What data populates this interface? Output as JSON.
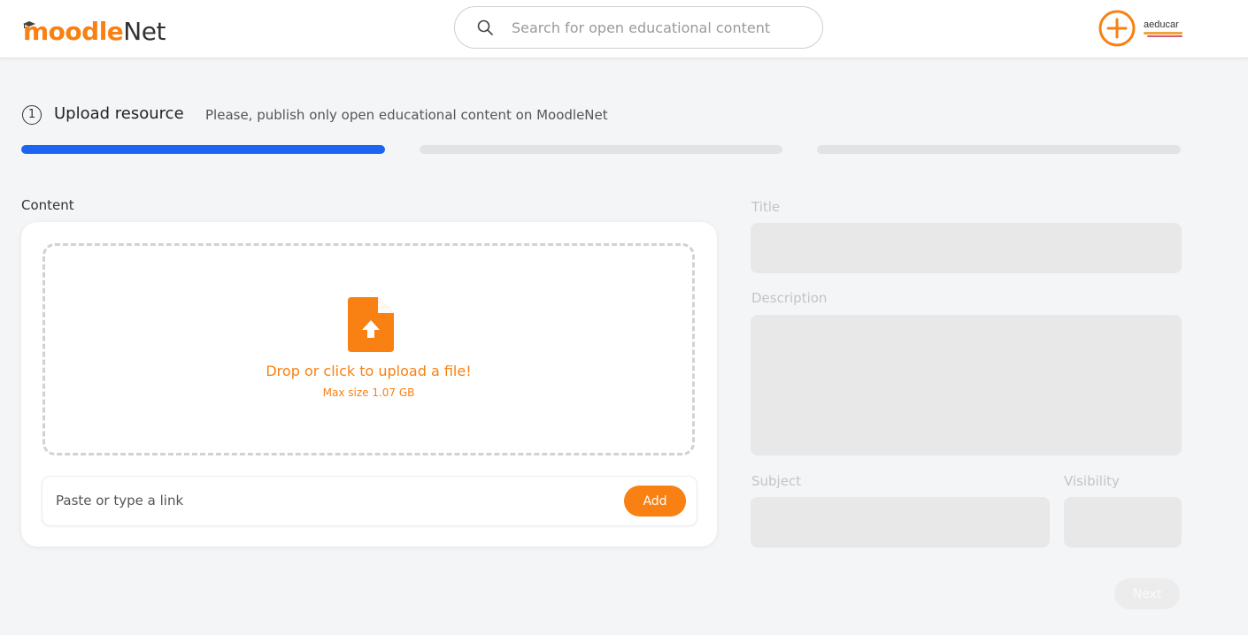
{
  "header": {
    "logo_primary": "moodle",
    "logo_secondary": "Net",
    "search_placeholder": "Search for open educational content",
    "avatar_text": "aeducar"
  },
  "step": {
    "number": "1",
    "title": "Upload resource",
    "hint": "Please, publish only open educational content on MoodleNet",
    "current": 1,
    "total": 3
  },
  "content": {
    "label": "Content",
    "drop_text": "Drop or click to upload a file!",
    "max_size": "Max size 1.07 GB",
    "link_placeholder": "Paste or type a link",
    "add_label": "Add"
  },
  "form": {
    "title_label": "Title",
    "description_label": "Description",
    "subject_label": "Subject",
    "visibility_label": "Visibility",
    "next_label": "Next"
  },
  "colors": {
    "brand_orange": "#f98012",
    "progress_active": "#1a66f0",
    "progress_inactive": "#e3e3e3"
  },
  "icons": {
    "search": "search-icon",
    "add": "plus-circle-icon",
    "upload": "file-upload-icon"
  }
}
